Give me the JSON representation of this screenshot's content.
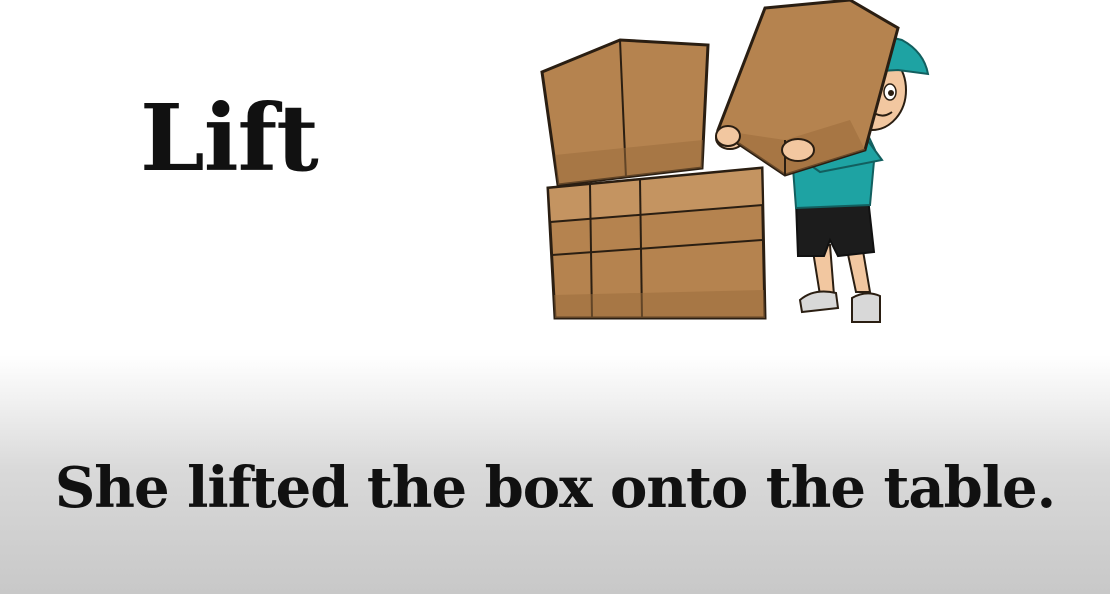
{
  "word": "Lift",
  "sentence": "She lifted the box onto the table.",
  "colors": {
    "text": "#111111",
    "box": "#b5834f",
    "box_shadow": "#9a6c3c",
    "shirt": "#1ea3a3",
    "shorts": "#1c1c1c",
    "skin": "#f2c7a0"
  },
  "illustration": {
    "subject_icon": "delivery-worker-lifting-box-icon",
    "stack_icon": "stacked-cardboard-boxes-icon"
  }
}
